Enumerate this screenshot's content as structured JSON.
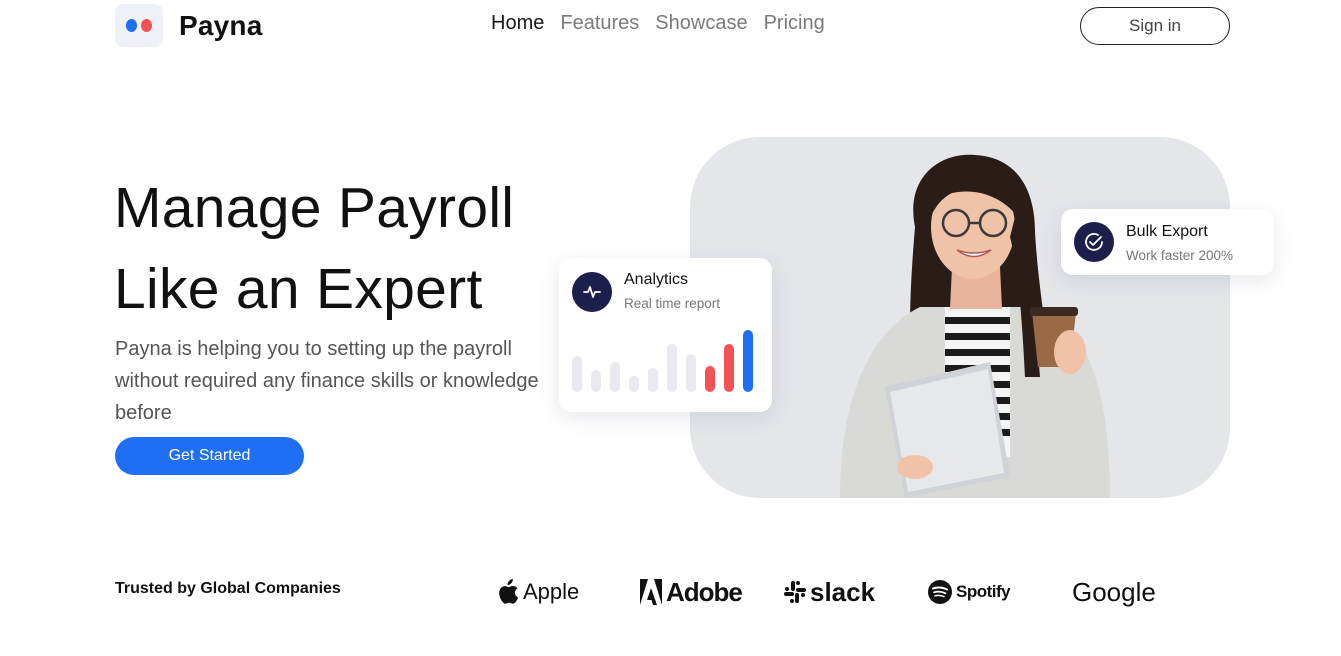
{
  "brand": {
    "name": "Payna",
    "accent_blue": "#1f6ff5",
    "accent_red": "#f25252",
    "dark": "#1c1f4a"
  },
  "nav": {
    "items": [
      {
        "label": "Home",
        "active": true
      },
      {
        "label": "Features",
        "active": false
      },
      {
        "label": "Showcase",
        "active": false
      },
      {
        "label": "Pricing",
        "active": false
      }
    ],
    "signin_label": "Sign in"
  },
  "hero": {
    "title_line1": "Manage Payroll",
    "title_line2": "Like an Expert",
    "description": "Payna is helping you to setting up the payroll without required any finance skills or knowledge before",
    "cta_label": "Get Started"
  },
  "analytics_card": {
    "icon": "activity-icon",
    "title": "Analytics",
    "subtitle": "Real time report"
  },
  "bulk_card": {
    "icon": "check-circle-icon",
    "title": "Bulk Export",
    "subtitle": "Work faster 200%"
  },
  "trusted": {
    "label": "Trusted by Global Companies",
    "brands": [
      "Apple",
      "Adobe",
      "slack",
      "Spotify",
      "Google"
    ]
  }
}
